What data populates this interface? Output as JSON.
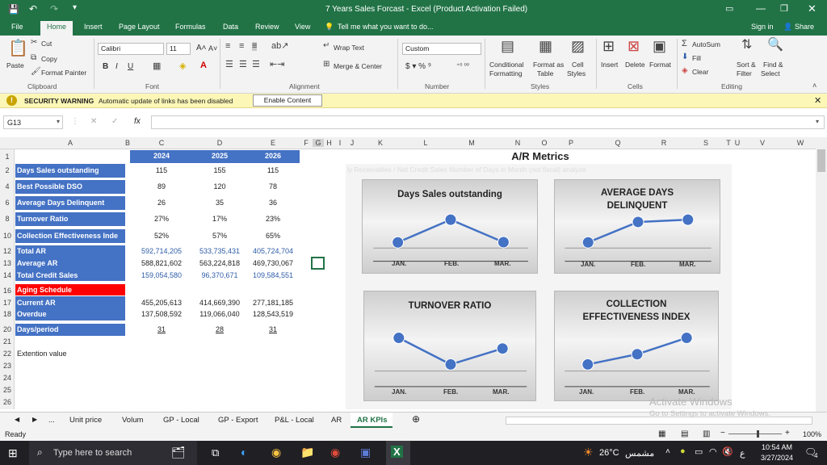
{
  "window": {
    "title": "7 Years Sales Forcast - Excel (Product Activation Failed)",
    "sign_in": "Sign in",
    "share": "Share"
  },
  "tabs": [
    "File",
    "Home",
    "Insert",
    "Page Layout",
    "Formulas",
    "Data",
    "Review",
    "View"
  ],
  "tell_me": "Tell me what you want to do...",
  "ribbon": {
    "clipboard": {
      "paste": "Paste",
      "cut": "Cut",
      "copy": "Copy",
      "format_painter": "Format Painter",
      "label": "Clipboard"
    },
    "font": {
      "name": "Calibri",
      "size": "11",
      "bold": "B",
      "italic": "I",
      "underline": "U",
      "label": "Font"
    },
    "alignment": {
      "wrap": "Wrap Text",
      "merge": "Merge & Center",
      "label": "Alignment"
    },
    "number": {
      "format": "Custom",
      "label": "Number"
    },
    "styles": {
      "cond": "Conditional",
      "cond2": "Formatting",
      "fmt_table": "Format as",
      "fmt_table2": "Table",
      "cell_styles": "Cell",
      "cell_styles2": "Styles",
      "label": "Styles"
    },
    "cells": {
      "insert": "Insert",
      "delete": "Delete",
      "format": "Format",
      "label": "Cells"
    },
    "editing": {
      "autosum": "AutoSum",
      "fill": "Fill",
      "clear": "Clear",
      "sort": "Sort &",
      "sort2": "Filter",
      "find": "Find &",
      "find2": "Select",
      "label": "Editing"
    }
  },
  "warning": {
    "title": "SECURITY WARNING",
    "text": "Automatic update of links has been disabled",
    "button": "Enable Content"
  },
  "formula": {
    "namebox": "G13",
    "fx": "fx"
  },
  "columns": [
    "A",
    "B",
    "C",
    "D",
    "E",
    "F",
    "G",
    "H",
    "I",
    "J",
    "K",
    "L",
    "M",
    "N",
    "O",
    "P",
    "Q",
    "R",
    "S",
    "T",
    "U",
    "V",
    "W"
  ],
  "rows": [
    "1",
    "2",
    "4",
    "6",
    "8",
    "10",
    "12",
    "13",
    "14",
    "16",
    "17",
    "18",
    "20",
    "21",
    "22",
    "23",
    "24",
    "25",
    "26"
  ],
  "sheet": {
    "years": [
      "2024",
      "2025",
      "2026"
    ],
    "kpis": [
      {
        "row": "2",
        "label": "Days Sales outstanding",
        "v": [
          "115",
          "155",
          "115"
        ]
      },
      {
        "row": "4",
        "label": "Best Possible DSO",
        "v": [
          "89",
          "120",
          "78"
        ]
      },
      {
        "row": "6",
        "label": "Average Days Delinquent",
        "v": [
          "26",
          "35",
          "36"
        ]
      },
      {
        "row": "8",
        "label": "Turnover Ratio",
        "v": [
          "27%",
          "17%",
          "23%"
        ]
      },
      {
        "row": "10",
        "label": "Collection Effectiveness Inde",
        "v": [
          "52%",
          "57%",
          "65%"
        ]
      }
    ],
    "totals": [
      {
        "row": "12",
        "label": "Total AR",
        "v": [
          "592,714,205",
          "533,735,431",
          "405,724,704"
        ],
        "color": "blue"
      },
      {
        "row": "13",
        "label": "Average AR",
        "v": [
          "588,821,602",
          "563,224,818",
          "469,730,067"
        ],
        "color": "dark"
      },
      {
        "row": "14",
        "label": "Total Credit Sales",
        "v": [
          "159,054,580",
          "96,370,671",
          "109,584,551"
        ],
        "color": "blue"
      }
    ],
    "aging": {
      "label": "Aging Schedule",
      "current_label": "Current AR",
      "current": [
        "455,205,613",
        "414,669,390",
        "277,181,185"
      ],
      "overdue_label": "Overdue",
      "overdue": [
        "137,508,592",
        "119,066,040",
        "128,543,519"
      ]
    },
    "days": {
      "label": "Days/period",
      "v": [
        "31",
        "28",
        "31"
      ]
    },
    "extension": "Extention value",
    "metrics_title": "A/R Metrics",
    "faded_text": "ly Receivables / Net Credit Sales  Number of Days in Month (not fiscal) analyze"
  },
  "charts": [
    {
      "title": "Days Sales outstanding",
      "labels": [
        "JAN.",
        "FEB.",
        "MAR."
      ],
      "values": [
        114.7,
        126.4,
        114.8
      ]
    },
    {
      "title": "AVERAGE DAYS DELINQUENT",
      "labels": [
        "JAN.",
        "FEB.",
        "MAR."
      ],
      "values": [
        26,
        35,
        36
      ]
    },
    {
      "title": "TURNOVER RATIO",
      "labels": [
        "JAN.",
        "FEB.",
        "MAR."
      ],
      "values": [
        0.27,
        0.17,
        0.23
      ]
    },
    {
      "title": "COLLECTION EFFECTIVENESS INDEX",
      "labels": [
        "JAN.",
        "FEB.",
        "MAR."
      ],
      "values": [
        0.52,
        0.57,
        0.65
      ]
    }
  ],
  "sheet_tabs": [
    "Unit price",
    "Volum",
    "GP - Local",
    "GP - Export",
    "P&L - Local",
    "AR",
    "AR KPIs"
  ],
  "status": {
    "ready": "Ready",
    "zoom": "100%"
  },
  "watermark": {
    "line1": "Activate Windows",
    "line2": "Go to Settings to activate Windows."
  },
  "taskbar": {
    "search": "Type here to search",
    "weather": "26°C",
    "weather_text": "مشمس",
    "lang": "ع",
    "time": "10:54 AM",
    "date": "3/27/2024",
    "notif": "4"
  },
  "colors": {
    "excel_green": "#217346",
    "header_blue": "#4472c4",
    "aging_red": "#ff0000",
    "line_blue": "#4472c4"
  }
}
